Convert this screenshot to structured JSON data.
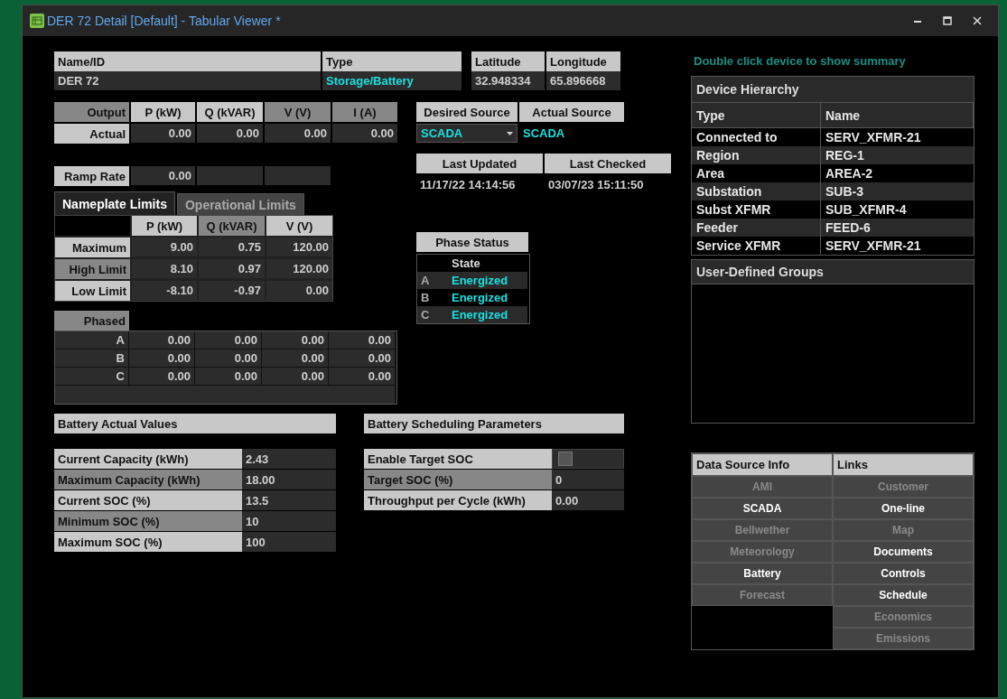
{
  "window": {
    "title": "DER 72 Detail [Default] - Tabular Viewer *"
  },
  "identity": {
    "columns": [
      "Name/ID",
      "Type"
    ],
    "name": "DER 72",
    "type": "Storage/Battery"
  },
  "location": {
    "columns": [
      "Latitude",
      "Longitude"
    ],
    "values": [
      "32.948334",
      "65.896668"
    ]
  },
  "output": {
    "columns": [
      "Output",
      "P (kW)",
      "Q (kVAR)",
      "V (V)",
      "I (A)"
    ],
    "row_label": "Actual",
    "values": [
      "0.00",
      "0.00",
      "0.00",
      "0.00"
    ]
  },
  "ramp_rate": {
    "label": "Ramp Rate",
    "value": "0.00"
  },
  "source": {
    "columns": [
      "Desired Source",
      "Actual Source"
    ],
    "desired": "SCADA",
    "actual": "SCADA"
  },
  "timestamps": {
    "columns": [
      "Last Updated",
      "Last Checked"
    ],
    "values": [
      "11/17/22 14:14:56",
      "03/07/23 15:11:50"
    ]
  },
  "limit_tabs": [
    {
      "label": "Nameplate Limits",
      "selected": true
    },
    {
      "label": "Operational Limits",
      "selected": false
    }
  ],
  "limits": {
    "columns": [
      "P (kW)",
      "Q (kVAR)",
      "V (V)"
    ],
    "rows": [
      {
        "label": "Maximum",
        "values": [
          "9.00",
          "0.75",
          "120.00"
        ]
      },
      {
        "label": "High Limit",
        "values": [
          "8.10",
          "0.97",
          "120.00"
        ]
      },
      {
        "label": "Low Limit",
        "values": [
          "-8.10",
          "-0.97",
          "0.00"
        ]
      }
    ]
  },
  "phased": {
    "title": "Phased",
    "rows": [
      {
        "label": "A",
        "values": [
          "0.00",
          "0.00",
          "0.00",
          "0.00"
        ]
      },
      {
        "label": "B",
        "values": [
          "0.00",
          "0.00",
          "0.00",
          "0.00"
        ]
      },
      {
        "label": "C",
        "values": [
          "0.00",
          "0.00",
          "0.00",
          "0.00"
        ]
      }
    ]
  },
  "phase_status": {
    "title": "Phase Status",
    "column": "State",
    "rows": [
      {
        "phase": "A",
        "state": "Energized"
      },
      {
        "phase": "B",
        "state": "Energized"
      },
      {
        "phase": "C",
        "state": "Energized"
      }
    ]
  },
  "battery_actual": {
    "title": "Battery Actual Values",
    "rows": [
      {
        "label": "Current Capacity (kWh)",
        "value": "2.43"
      },
      {
        "label": "Maximum Capacity (kWh)",
        "value": "18.00"
      },
      {
        "label": "Current SOC (%)",
        "value": "13.5"
      },
      {
        "label": "Minimum SOC (%)",
        "value": "10"
      },
      {
        "label": "Maximum SOC (%)",
        "value": "100"
      }
    ]
  },
  "battery_scheduling": {
    "title": "Battery Scheduling Parameters",
    "rows": [
      {
        "kind": "checkbox",
        "label": "Enable Target SOC",
        "checked": false
      },
      {
        "kind": "value",
        "label": "Target SOC (%)",
        "value": "0"
      },
      {
        "kind": "value",
        "label": "Throughput per Cycle (kWh)",
        "value": "0.00"
      }
    ]
  },
  "hint": "Double click device to show summary",
  "hierarchy": {
    "title": "Device Hierarchy",
    "columns": [
      "Type",
      "Name"
    ],
    "rows": [
      {
        "type": "Connected to",
        "name": "SERV_XFMR-21"
      },
      {
        "type": "Region",
        "name": "REG-1"
      },
      {
        "type": "Area",
        "name": "AREA-2"
      },
      {
        "type": "Substation",
        "name": "SUB-3"
      },
      {
        "type": "Subst XFMR",
        "name": "SUB_XFMR-4"
      },
      {
        "type": "Feeder",
        "name": "FEED-6"
      },
      {
        "type": "Service XFMR",
        "name": "SERV_XFMR-21"
      }
    ]
  },
  "groups": {
    "title": "User-Defined Groups"
  },
  "data_sources": {
    "title": "Data Source Info",
    "items": [
      {
        "label": "AMI",
        "disabled": true
      },
      {
        "label": "SCADA",
        "disabled": false
      },
      {
        "label": "Bellwether",
        "disabled": true
      },
      {
        "label": "Meteorology",
        "disabled": true
      },
      {
        "label": "Battery",
        "disabled": false
      },
      {
        "label": "Forecast",
        "disabled": true
      }
    ]
  },
  "links": {
    "title": "Links",
    "items": [
      {
        "label": "Customer",
        "disabled": true
      },
      {
        "label": "One-line",
        "disabled": false
      },
      {
        "label": "Map",
        "disabled": true
      },
      {
        "label": "Documents",
        "disabled": false
      },
      {
        "label": "Controls",
        "disabled": false
      },
      {
        "label": "Schedule",
        "disabled": false
      },
      {
        "label": "Economics",
        "disabled": true
      },
      {
        "label": "Emissions",
        "disabled": true
      }
    ]
  }
}
